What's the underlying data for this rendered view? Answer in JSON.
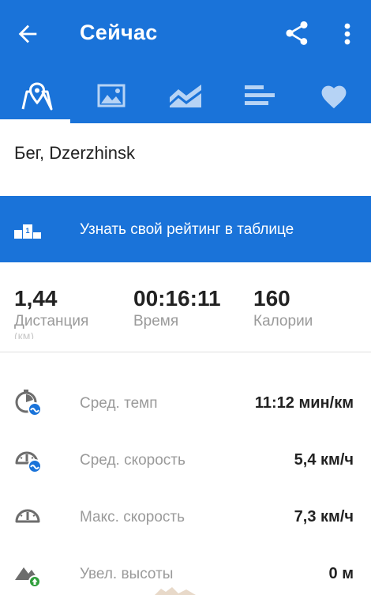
{
  "appbar": {
    "title": "Сейчас"
  },
  "tabs": [
    {
      "name": "map"
    },
    {
      "name": "photos"
    },
    {
      "name": "charts"
    },
    {
      "name": "splits"
    },
    {
      "name": "likes"
    }
  ],
  "activity": {
    "title": "Бег, Dzerzhinsk"
  },
  "banner": {
    "text": "Узнать свой рейтинг в таблице"
  },
  "stats": [
    {
      "value": "1,44",
      "label": "Дистанция"
    },
    {
      "value": "00:16:11",
      "label": "Время"
    },
    {
      "value": "160",
      "label": "Калории"
    }
  ],
  "stats_sub": "(км)",
  "details": [
    {
      "icon": "pace-icon",
      "label": "Сред. темп",
      "value": "11:12 мин/км"
    },
    {
      "icon": "speedometer-icon",
      "label": "Сред. скорость",
      "value": "5,4 км/ч"
    },
    {
      "icon": "speedometer-icon",
      "label": "Макс. скорость",
      "value": "7,3 км/ч"
    },
    {
      "icon": "elevation-icon",
      "label": "Увел. высоты",
      "value": "0 м"
    }
  ],
  "colors": {
    "primary": "#1a73d9",
    "badge": "#1a73d9",
    "elevation_badge": "#2e9e3a"
  }
}
